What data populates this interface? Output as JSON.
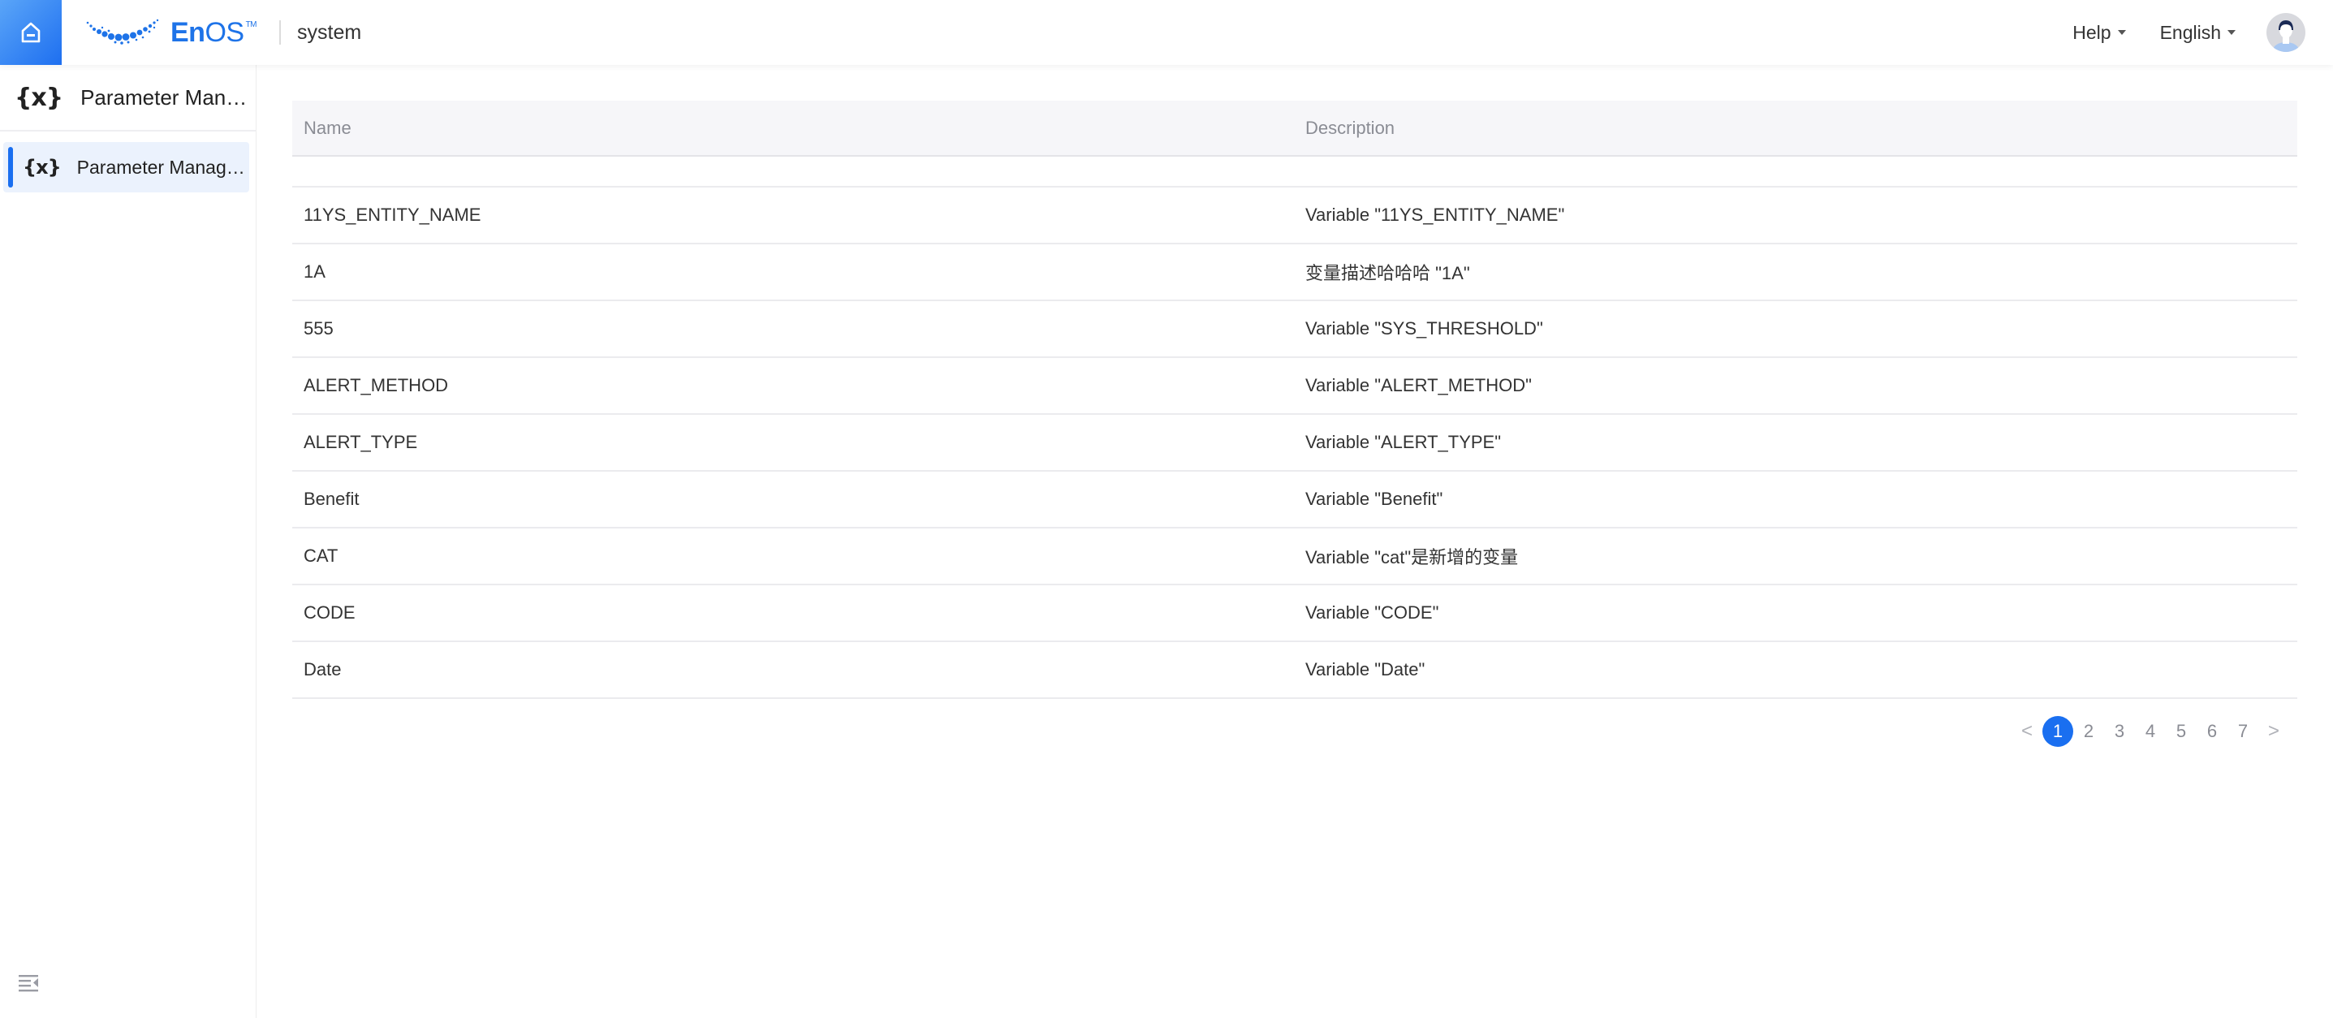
{
  "header": {
    "logo_text_bold": "En",
    "logo_text_light": "OS",
    "logo_trademark": "TM",
    "app_name": "system",
    "help_label": "Help",
    "language_label": "English"
  },
  "sidebar": {
    "title": "Parameter Manag...",
    "items": [
      {
        "label": "Parameter Manage...",
        "active": true
      }
    ]
  },
  "table": {
    "columns": [
      "Name",
      "Description"
    ],
    "rows": [
      {
        "name": "11YS_ENTITY_NAME",
        "description": "Variable \"11YS_ENTITY_NAME\""
      },
      {
        "name": "1A",
        "description": "变量描述哈哈哈 \"1A\""
      },
      {
        "name": "555",
        "description": "Variable \"SYS_THRESHOLD\""
      },
      {
        "name": "ALERT_METHOD",
        "description": "Variable \"ALERT_METHOD\""
      },
      {
        "name": "ALERT_TYPE",
        "description": "Variable \"ALERT_TYPE\""
      },
      {
        "name": "Benefit",
        "description": "Variable \"Benefit\""
      },
      {
        "name": "CAT",
        "description": "Variable \"cat\"是新增的变量"
      },
      {
        "name": "CODE",
        "description": "Variable \"CODE\""
      },
      {
        "name": "Date",
        "description": "Variable \"Date\""
      }
    ]
  },
  "pagination": {
    "prev": "<",
    "next": ">",
    "pages": [
      "1",
      "2",
      "3",
      "4",
      "5",
      "6",
      "7"
    ],
    "current": "1"
  },
  "colors": {
    "accent": "#1a6ff0",
    "sidebar_active_bg": "#ebf2fd",
    "table_header_bg": "#f6f6f9"
  }
}
